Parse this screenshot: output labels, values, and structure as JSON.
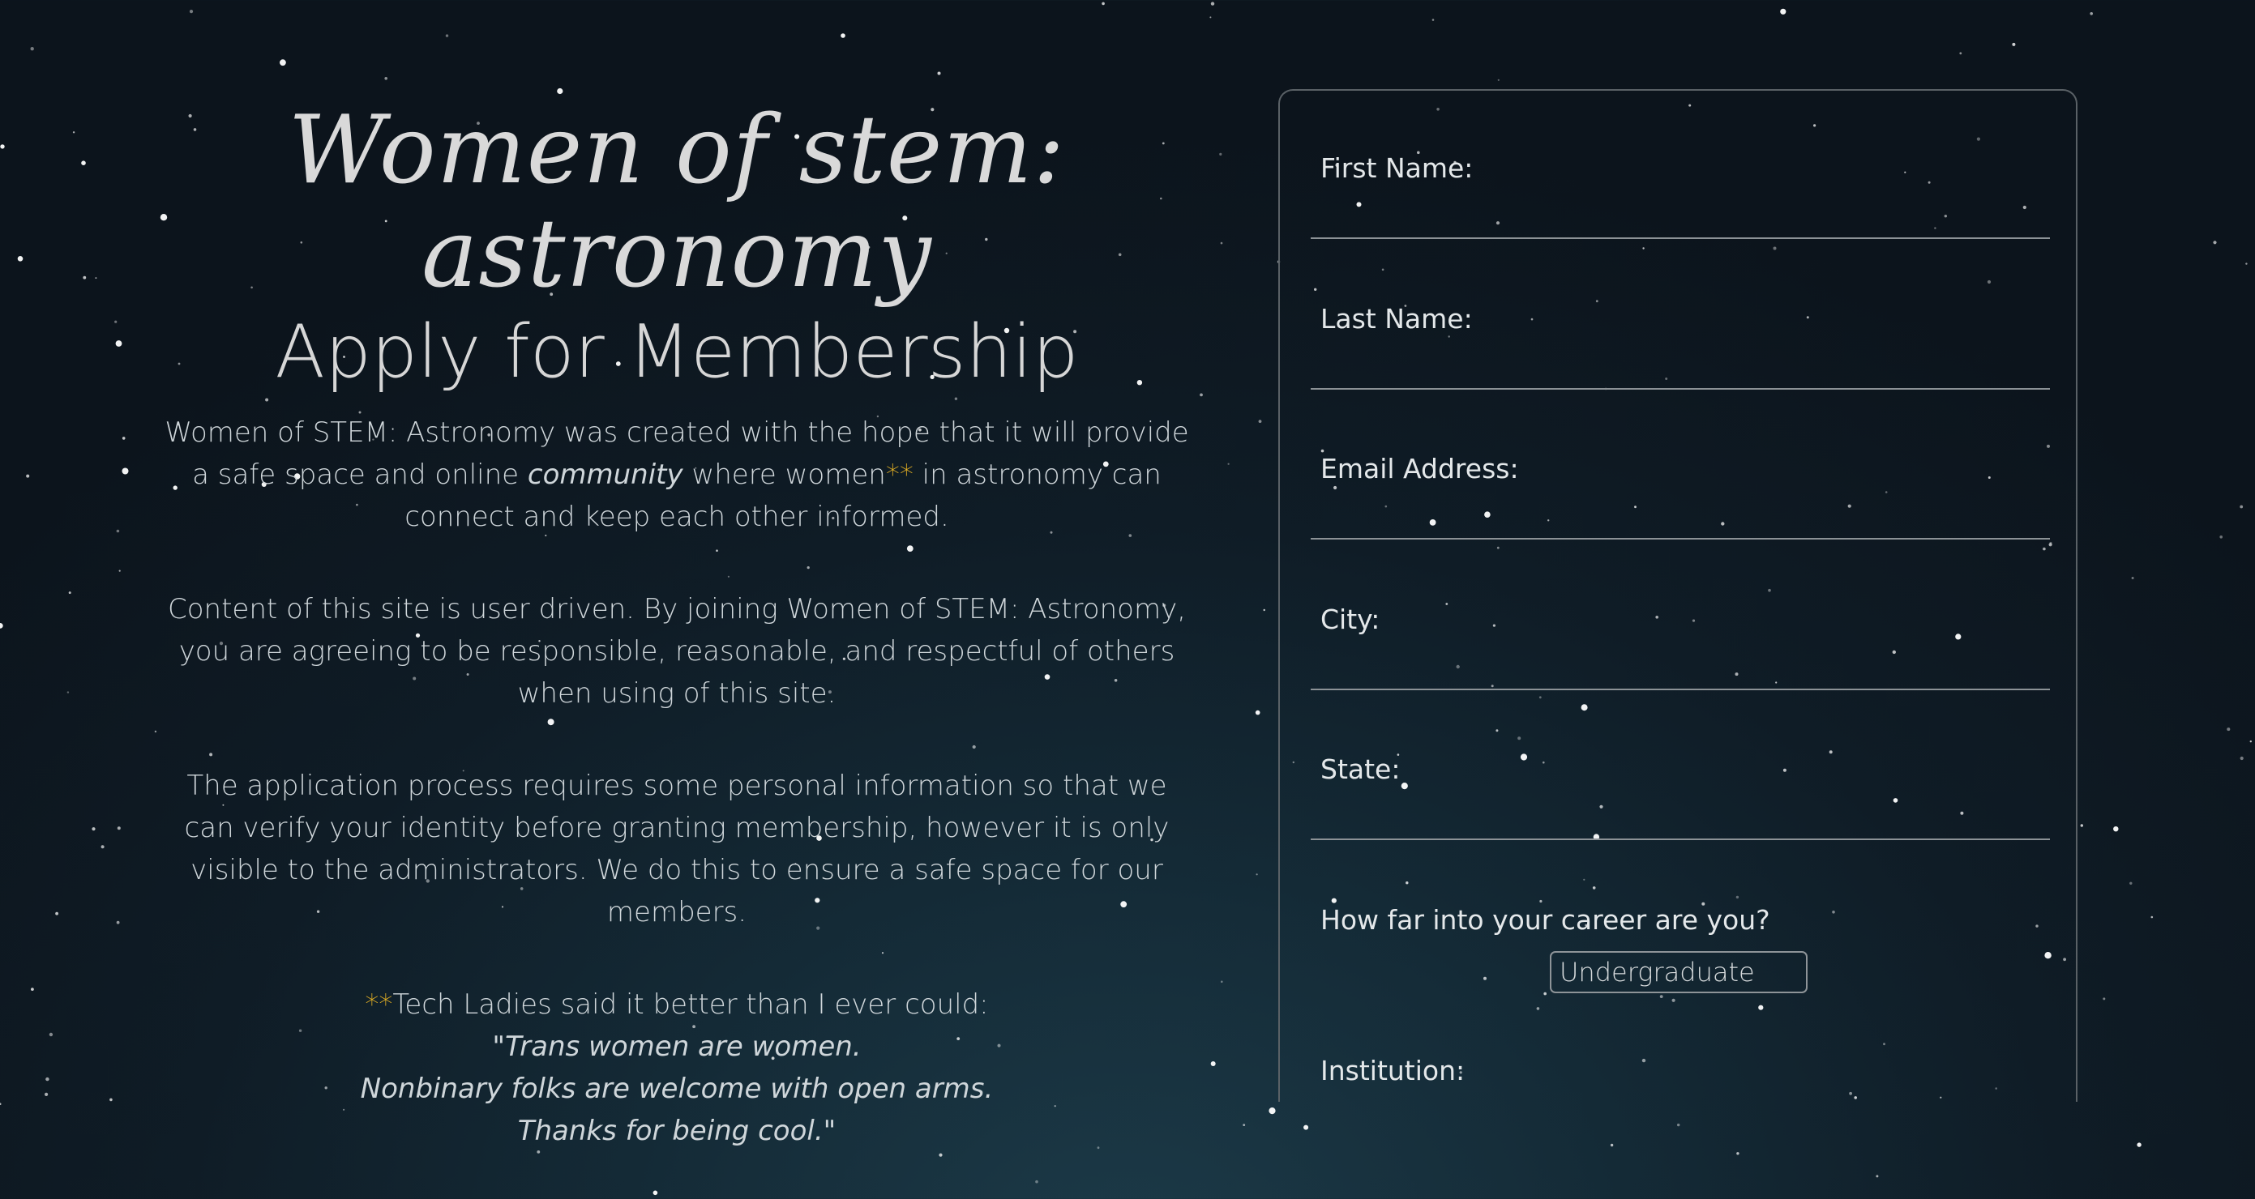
{
  "header": {
    "brand": "Women of stem: astronomy",
    "heading": "Apply for Membership"
  },
  "intro": {
    "p1_a": "Women of STEM: Astronomy was created with the hope that it will provide a safe space and online ",
    "p1_community": "community",
    "p1_b": " where women",
    "p1_stars": "**",
    "p1_c": " in astronomy can connect and keep each other informed.",
    "p2": "Content of this site is user driven. By joining Women of STEM: Astronomy, you are agreeing to be responsible, reasonable, and respectful of others when using of this site.",
    "p3": "The application process requires some personal information so that we can verify your identity before granting membership, however it is only visible to the administrators. We do this to ensure a safe space for our members.",
    "p4_stars": "**",
    "p4_a": "Tech Ladies said it better than I ever could:",
    "quote_1": "\"Trans women are women.",
    "quote_2": "Nonbinary folks are welcome with open arms.",
    "quote_3": "Thanks for being cool.\""
  },
  "form": {
    "first_name_label": "First Name:",
    "last_name_label": "Last Name:",
    "email_label": "Email Address:",
    "city_label": "City:",
    "state_label": "State:",
    "career_label": "How far into your career are you?",
    "career_selected": "Undergraduate",
    "institution_label": "Institution:"
  },
  "colors": {
    "accent_gold": "#e8b323",
    "background": "#0f1c26"
  }
}
